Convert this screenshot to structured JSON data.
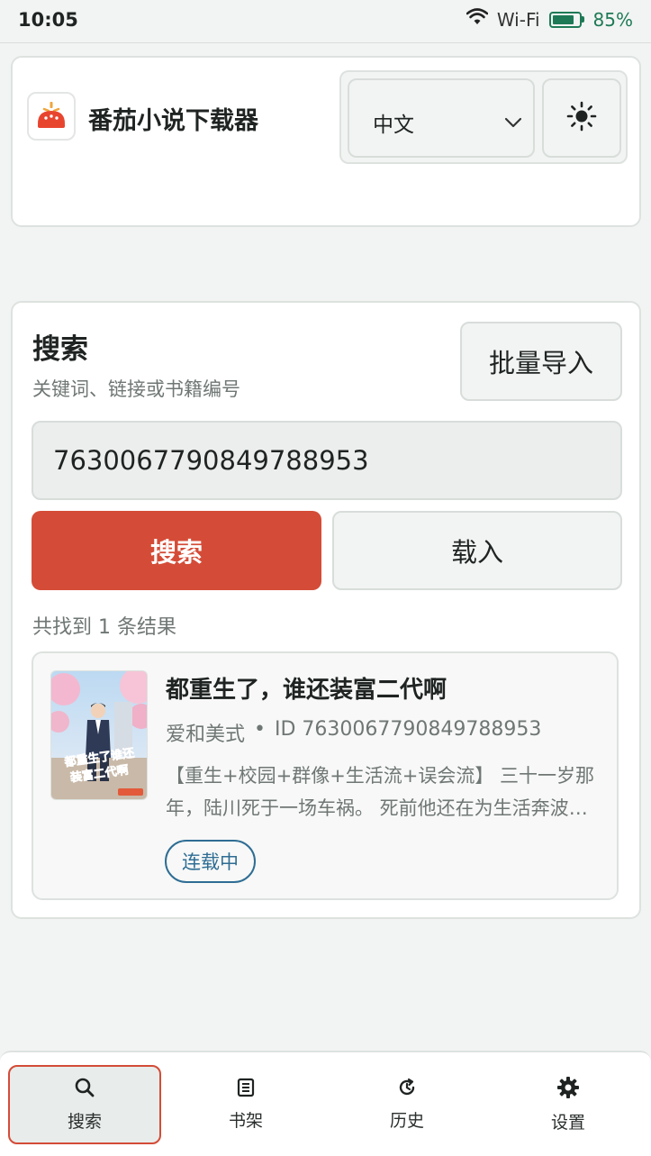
{
  "status_bar": {
    "time": "10:05",
    "wifi_label": "Wi-Fi",
    "battery_percent": "85%",
    "battery_level": 0.85
  },
  "header": {
    "app_title": "番茄小说下载器",
    "language_selected": "中文",
    "theme_icon": "sun-icon"
  },
  "search": {
    "title": "搜索",
    "subtitle": "关键词、链接或书籍编号",
    "batch_import_label": "批量导入",
    "input_value": "7630067790849788953",
    "search_button_label": "搜索",
    "load_button_label": "载入",
    "result_count_text": "共找到 1 条结果"
  },
  "results": [
    {
      "title": "都重生了，谁还装富二代啊",
      "author": "爱和美式",
      "separator": "•",
      "id_text": "ID 7630067790849788953",
      "description": "【重生+校园+群像+生活流+误会流】 三十一岁那年，陆川死于一场车祸。 死前他还在为生活奔波，这一世他决定…",
      "status": "连载中",
      "cover_text": "都重生了谁还装富二代啊"
    }
  ],
  "bottom_nav": {
    "items": [
      {
        "label": "搜索",
        "icon": "search-icon",
        "active": true
      },
      {
        "label": "书架",
        "icon": "bookshelf-icon",
        "active": false
      },
      {
        "label": "历史",
        "icon": "history-icon",
        "active": false
      },
      {
        "label": "设置",
        "icon": "gear-icon",
        "active": false
      }
    ]
  },
  "colors": {
    "accent": "#d44c37",
    "status_blue": "#2f6d94",
    "battery_green": "#1e7a56",
    "background": "#f2f4f3"
  }
}
